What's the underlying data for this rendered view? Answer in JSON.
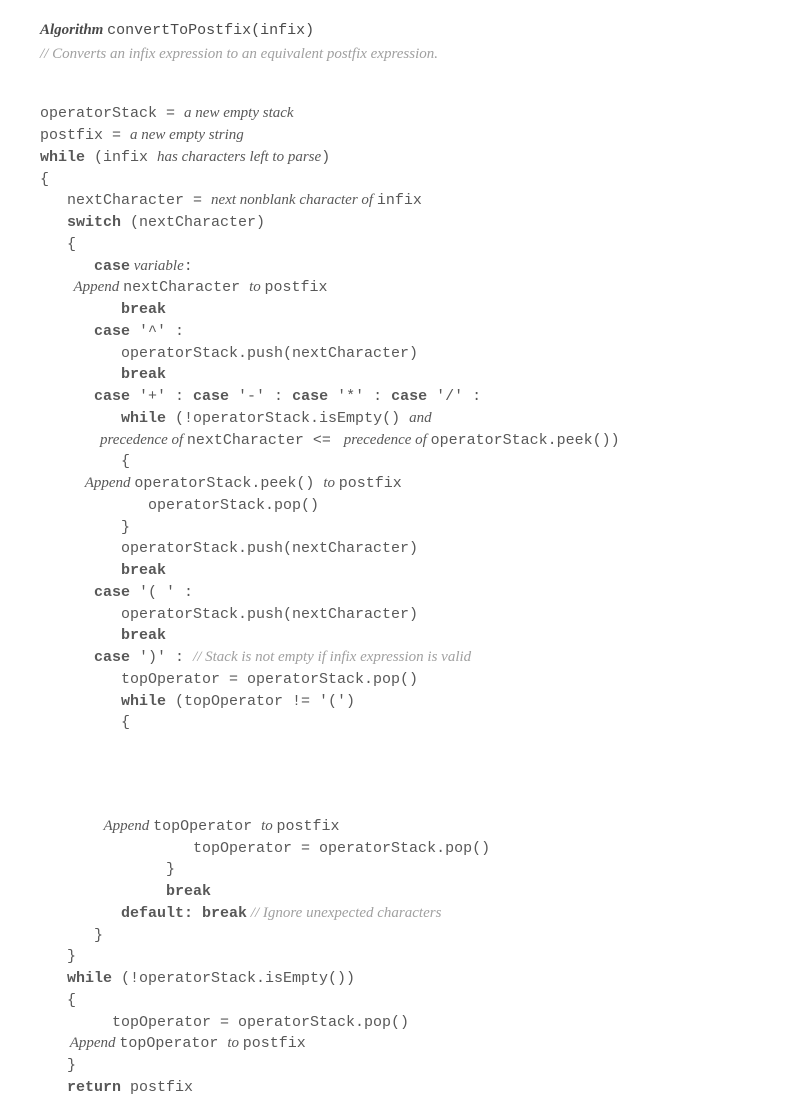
{
  "title": {
    "algorithm_label": "Algorithm",
    "func_name": "convertToPostfix(infix)"
  },
  "description_comment": "//  Converts an infix expression to an equivalent postfix expression.",
  "lines": {
    "l1a": "operatorStack = ",
    "l1b": "a new empty stack",
    "l2a": "postfix = ",
    "l2b": "a new empty string",
    "l3a": "while",
    "l3b": " (infix ",
    "l3c": "has characters left to parse",
    "l3d": ")",
    "l4": "{",
    "l5a": "   nextCharacter = ",
    "l5b": "next nonblank character of ",
    "l5c": "infix",
    "l6a": "   switch",
    "l6b": " (nextCharacter)",
    "l7": "   {",
    "l8a": "      case",
    "l8b": " variable",
    "l8c": ":",
    "l9a": "         Append ",
    "l9b": "nextCharacter ",
    "l9c": "to ",
    "l9d": "postfix",
    "l10a": "         break",
    "l11a": "      case",
    "l11b": " '^' :",
    "l12": "         operatorStack.push(nextCharacter)",
    "l13a": "         break",
    "l14a": "      case",
    "l14b": " '+' : ",
    "l14c": "case",
    "l14d": " '-' : ",
    "l14e": "case",
    "l14f": " '*' : ",
    "l14g": "case",
    "l14h": " '/' :",
    "l15a": "         while",
    "l15b": " (!operatorStack.isEmpty() ",
    "l15c": "and",
    "l16a": "                precedence of ",
    "l16b": "nextCharacter <= ",
    "l16c": " precedence of ",
    "l16d": "operatorStack.peek())",
    "l17": "         {",
    "l18a": "            Append ",
    "l18b": "operatorStack.peek() ",
    "l18c": "to ",
    "l18d": "postfix",
    "l19": "            operatorStack.pop()",
    "l20": "         }",
    "l21": "         operatorStack.push(nextCharacter)",
    "l22a": "         break",
    "l23a": "      case",
    "l23b": " '( ' :",
    "l24": "         operatorStack.push(nextCharacter)",
    "l25a": "         break",
    "l26a": "      case",
    "l26b": " ')' : ",
    "l26c": "// Stack is not empty if infix expression is valid",
    "l27": "         topOperator = operatorStack.pop()",
    "l28a": "         while",
    "l28b": " (topOperator != '(')",
    "l29": "         {",
    "l30a": "                 Append ",
    "l30b": "topOperator ",
    "l30c": "to ",
    "l30d": "postfix",
    "l31": "                 topOperator = operatorStack.pop()",
    "l32": "              }",
    "l33a": "              break",
    "l34a": "         default: break",
    "l34b": " // Ignore unexpected characters",
    "l35": "      }",
    "l36": "   }",
    "l37a": "   while",
    "l37b": " (!operatorStack.isEmpty())",
    "l38": "   {",
    "l39": "        topOperator = operatorStack.pop()",
    "l40a": "        Append ",
    "l40b": "topOperator ",
    "l40c": "to ",
    "l40d": "postfix",
    "l41": "   }",
    "l42a": "   return",
    "l42b": " postfix"
  }
}
